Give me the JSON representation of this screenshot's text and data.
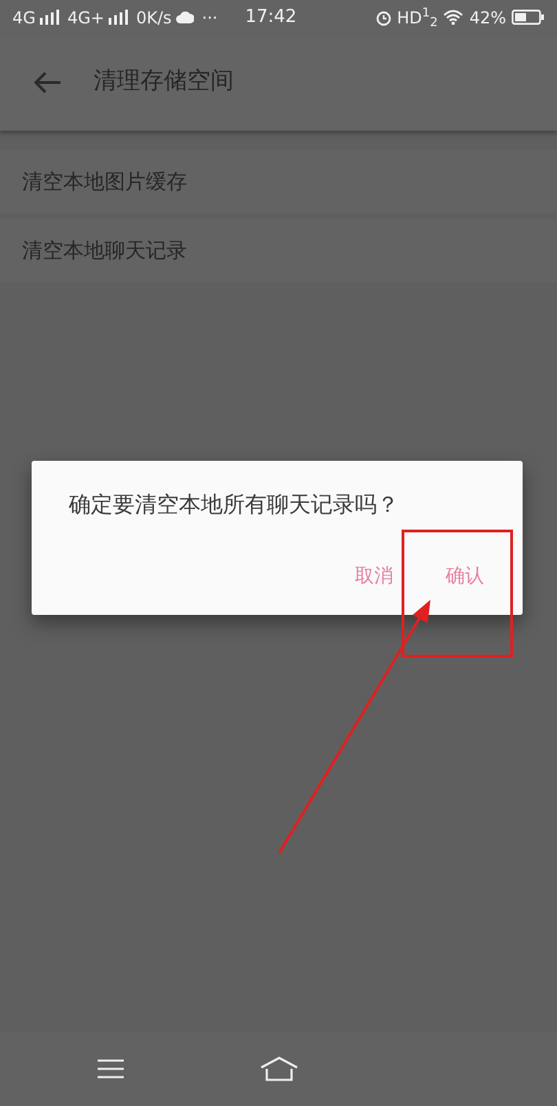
{
  "status_bar": {
    "left": [
      "4G",
      "4G+",
      "0K/s",
      "···"
    ],
    "time": "17:42",
    "hd": "HD$^{1}$$_{2}$",
    "battery": "42%"
  },
  "toolbar": {
    "title": "清理存储空间"
  },
  "list": [
    {
      "label": "清空本地图片缓存"
    },
    {
      "label": "清空本地聊天记录"
    }
  ],
  "dialog": {
    "message": "确定要清空本地所有聊天记录吗？",
    "buttons": [
      "取消",
      "确认"
    ]
  }
}
